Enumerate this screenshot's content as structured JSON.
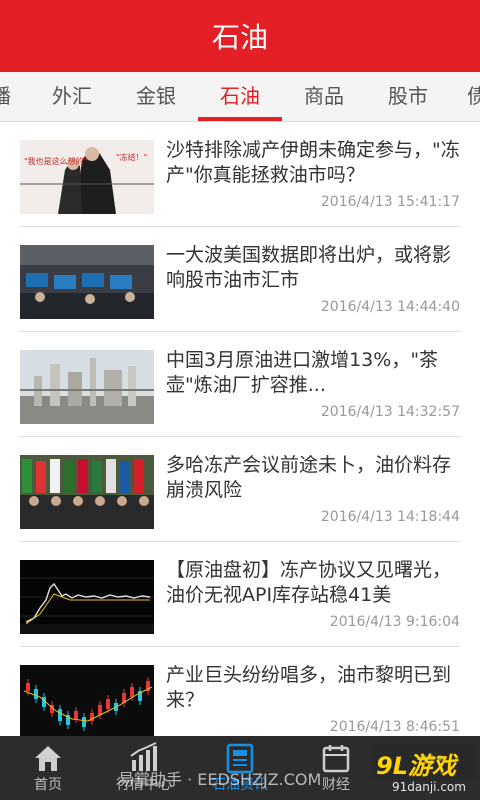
{
  "header": {
    "title": "石油"
  },
  "tabs": [
    {
      "label": "播"
    },
    {
      "label": "外汇"
    },
    {
      "label": "金银"
    },
    {
      "label": "石油",
      "active": true
    },
    {
      "label": "商品"
    },
    {
      "label": "股市"
    },
    {
      "label": "债"
    }
  ],
  "news": [
    {
      "title": "沙特排除减产伊朗未确定参与，\"冻产\"你真能拯救油市吗？",
      "time": "2016/4/13 15:41:17",
      "thumb_text": {
        "left": "\"我也是这么想的\"",
        "right": "\"冻结！\""
      }
    },
    {
      "title": "一大波美国数据即将出炉，或将影响股市油市汇市",
      "time": "2016/4/13 14:44:40"
    },
    {
      "title": "中国3月原油进口激增13%，\"茶壶\"炼油厂扩容推...",
      "time": "2016/4/13 14:32:57"
    },
    {
      "title": "多哈冻产会议前途未卜，油价料存崩溃风险",
      "time": "2016/4/13 14:18:44"
    },
    {
      "title": "【原油盘初】冻产协议又见曙光，油价无视API库存站稳41美",
      "time": "2016/4/13 9:16:04"
    },
    {
      "title": "产业巨头纷纷唱多，油市黎明已到来？",
      "time": "2016/4/13 8:46:51"
    }
  ],
  "bottom_nav": [
    {
      "label": "首页",
      "icon": "home-icon"
    },
    {
      "label": "行情中心",
      "icon": "chart-icon"
    },
    {
      "label": "石油资讯",
      "icon": "news-icon",
      "active": true
    },
    {
      "label": "财经",
      "icon": "calendar-icon"
    },
    {
      "label": "",
      "icon": "more-icon"
    }
  ],
  "watermarks": {
    "left": "易掌助手 · EEDSHZJZ.COM",
    "right_logo": "9L游戏",
    "right_url": "91danji.com"
  },
  "colors": {
    "brand_red": "#e41f26",
    "active_blue": "#1a8fe6",
    "nav_bg": "#2c2c2c"
  }
}
